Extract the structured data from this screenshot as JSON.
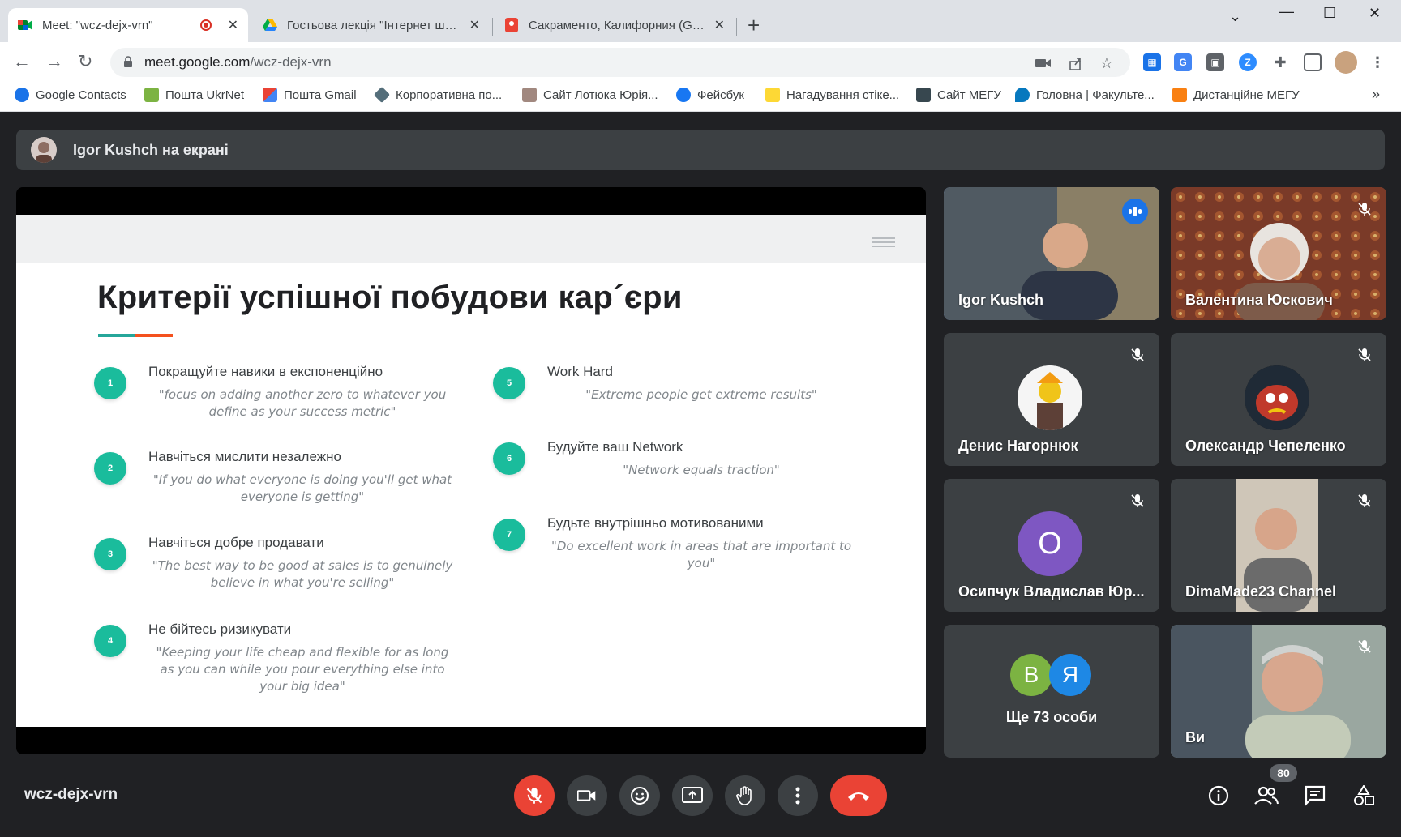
{
  "browser": {
    "tabs": [
      {
        "title": "Meet: \"wcz-dejx-vrn\"",
        "active": true
      },
      {
        "title": "Гостьова лекція \"Інтернет шахр",
        "active": false
      },
      {
        "title": "Сакраменто, Калифорния (Goog",
        "active": false
      }
    ],
    "url_host": "meet.google.com",
    "url_path": "/wcz-dejx-vrn",
    "bookmarks": [
      "Google Contacts",
      "Пошта UkrNet",
      "Пошта Gmail",
      "Корпоративна по...",
      "Сайт Лотюка Юрія...",
      "Фейсбук",
      "Нагадування стіке...",
      "Сайт МЕГУ",
      "Головна | Факульте...",
      "Дистанційне МЕГУ"
    ],
    "bookmarks_more": "»"
  },
  "meet": {
    "presenter_banner": "Igor Kushch на екрані",
    "meeting_code": "wcz-dejx-vrn",
    "participant_count": "80",
    "slide": {
      "title": "Критерії успішної побудови кар´єри",
      "items": [
        {
          "num": "1",
          "heading": "Покращуйте навики в експоненційно",
          "quote": "\"focus on adding another zero to whatever you define as your success metric\""
        },
        {
          "num": "2",
          "heading": "Навчіться мислити незалежно",
          "quote": "\"If you do what everyone is doing you'll get what everyone is getting\""
        },
        {
          "num": "3",
          "heading": "Навчіться добре продавати",
          "quote": "\"The best way to be good at sales is to genuinely believe in what you're selling\""
        },
        {
          "num": "4",
          "heading": "Не бійтесь ризикувати",
          "quote": "\"Keeping your life cheap and flexible for as long as you can while you pour everything else into your big idea\""
        },
        {
          "num": "5",
          "heading": "Work Hard",
          "quote": "\"Extreme people get extreme results\""
        },
        {
          "num": "6",
          "heading": "Будуйте ваш Network",
          "quote": "\"Network equals traction\""
        },
        {
          "num": "7",
          "heading": "Будьте внутрішньо мотивованими",
          "quote": "\"Do excellent work in areas that are important to you\""
        }
      ]
    },
    "participants": [
      {
        "name": "Igor Kushch",
        "speaking": true
      },
      {
        "name": "Валентина Юскович",
        "muted": true
      },
      {
        "name": "Денис Нагорнюк",
        "muted": true
      },
      {
        "name": "Олександр Чепеленко",
        "muted": true
      },
      {
        "name": "Осипчук Владислав Юр...",
        "muted": true,
        "initial": "О"
      },
      {
        "name": "DimaMade23 Channel",
        "muted": true
      },
      {
        "name": "Ще 73 особи",
        "initials": [
          "В",
          "Я"
        ]
      },
      {
        "name": "Ви",
        "muted": true
      }
    ],
    "colors": {
      "background": "#202124",
      "tile": "#3c4043",
      "danger": "#ea4335",
      "accent_teal": "#1abc9c",
      "speaking_outline": "#8ab4f8"
    }
  }
}
